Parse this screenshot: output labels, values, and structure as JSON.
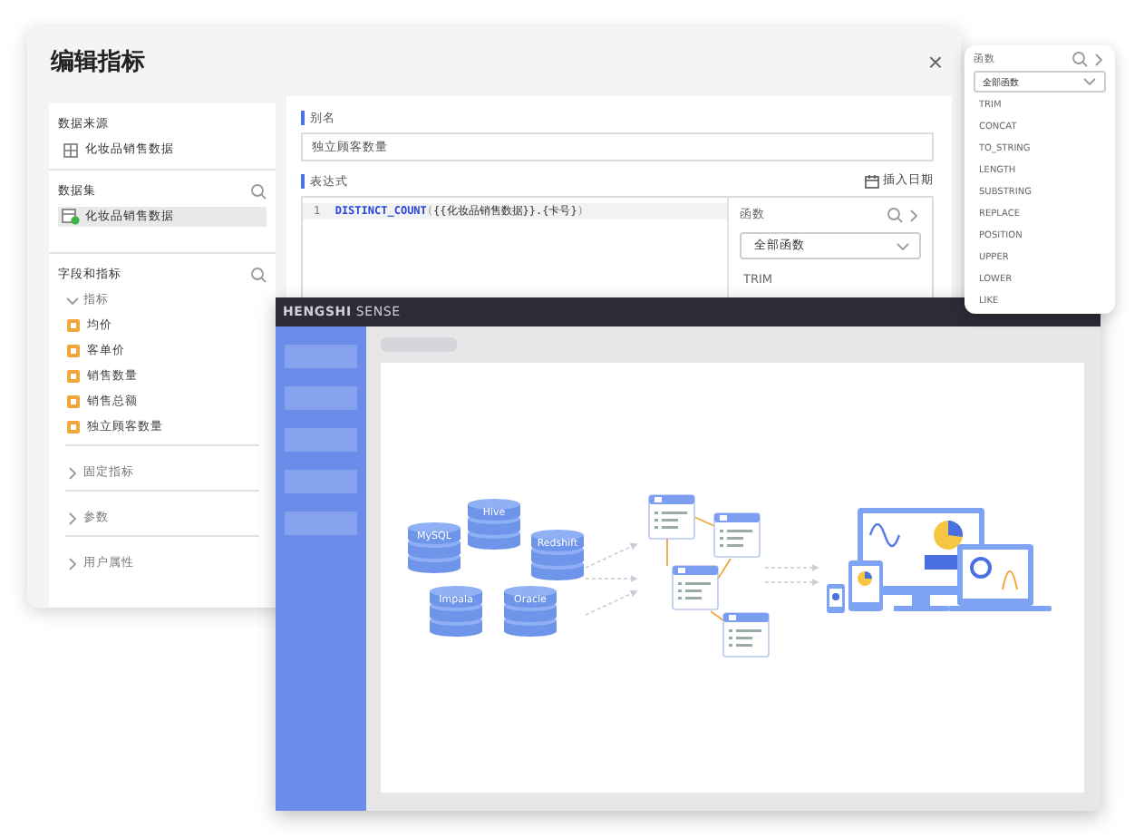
{
  "editor": {
    "title": "编辑指标",
    "close": "×",
    "data_source": {
      "title": "数据来源",
      "item": "化妆品销售数据"
    },
    "dataset": {
      "title": "数据集",
      "items": [
        {
          "label": "化妆品销售数据",
          "selected": true
        }
      ]
    },
    "fields": {
      "title": "字段和指标",
      "groups": [
        {
          "label": "指标",
          "expanded": true,
          "children": [
            {
              "label": "均价"
            },
            {
              "label": "客单价"
            },
            {
              "label": "销售数量"
            },
            {
              "label": "销售总额"
            },
            {
              "label": "独立顾客数量"
            }
          ]
        },
        {
          "label": "固定指标",
          "expanded": false
        },
        {
          "label": "参数",
          "expanded": false
        },
        {
          "label": "用户属性",
          "expanded": false
        }
      ]
    },
    "alias": {
      "label": "别名",
      "value": "独立顾客数量"
    },
    "expression": {
      "label": "表达式",
      "insert_date": "插入日期",
      "lines": [
        {
          "number": "1",
          "code": [
            {
              "kind": "function",
              "text": "DISTINCT_COUNT"
            },
            {
              "kind": "paren",
              "text": "("
            },
            {
              "kind": "field",
              "text": "{{化妆品销售数据}}.{卡号}"
            },
            {
              "kind": "paren",
              "text": ")"
            }
          ]
        }
      ]
    },
    "function_panel": {
      "title": "函数",
      "category": "全部函数",
      "items": [
        "TRIM"
      ]
    }
  },
  "function_popup": {
    "title": "函数",
    "category": "全部函数",
    "items": [
      "TRIM",
      "CONCAT",
      "TO_STRING",
      "LENGTH",
      "SUBSTRING",
      "REPLACE",
      "POSITION",
      "UPPER",
      "LOWER",
      "LIKE"
    ]
  },
  "app": {
    "brand": "**HENGSHI** SENSE",
    "diagram": {
      "databases": [
        "MySQL",
        "Hive",
        "Redshift",
        "Impala",
        "Oracle"
      ]
    }
  }
}
